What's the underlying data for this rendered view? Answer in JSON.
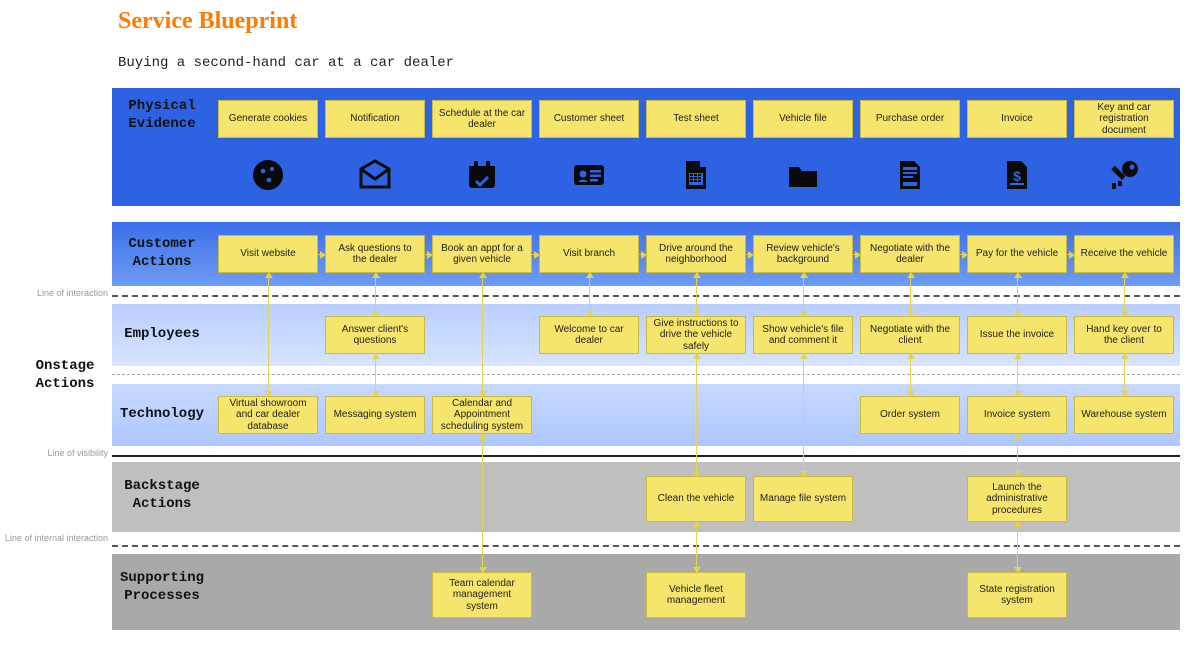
{
  "title": "Service Blueprint",
  "subtitle": "Buying a second-hand car at a car dealer",
  "lanes": {
    "physical": "Physical Evidence",
    "customer": "Customer Actions",
    "onstage": "Onstage Actions",
    "employees": "Employees",
    "technology": "Technology",
    "backstage": "Backstage Actions",
    "supporting": "Supporting Processes"
  },
  "lines": {
    "interaction": "Line of interaction",
    "visibility": "Line of visibility",
    "internal": "Line of internal interaction"
  },
  "columns": [
    {
      "physical": "Generate cookies",
      "icon": "cookie",
      "customer": "Visit website",
      "technology": "Virtual showroom and car dealer database"
    },
    {
      "physical": "Notification",
      "icon": "envelope",
      "customer": "Ask questions to the dealer",
      "employee": "Answer client's questions",
      "technology": "Messaging system"
    },
    {
      "physical": "Schedule at the car dealer",
      "icon": "calendar",
      "customer": "Book an appt for a given vehicle",
      "technology": "Calendar and Appointment scheduling system",
      "supporting": "Team calendar management system"
    },
    {
      "physical": "Customer sheet",
      "icon": "idcard",
      "customer": "Visit branch",
      "employee": "Welcome to car dealer"
    },
    {
      "physical": "Test sheet",
      "icon": "sheet",
      "customer": "Drive around the neighborhood",
      "employee": "Give instructions to drive the vehicle safely",
      "backstage": "Clean the vehicle",
      "supporting": "Vehicle fleet management"
    },
    {
      "physical": "Vehicle file",
      "icon": "folder",
      "customer": "Review vehicle's background",
      "employee": "Show vehicle's file and comment it",
      "backstage": "Manage file system"
    },
    {
      "physical": "Purchase order",
      "icon": "order",
      "customer": "Negotiate with the dealer",
      "employee": "Negotiate with the client",
      "technology": "Order system"
    },
    {
      "physical": "Invoice",
      "icon": "invoice",
      "customer": "Pay for the vehicle",
      "employee": "Issue the invoice",
      "technology": "Invoice system",
      "backstage": "Launch the administrative procedures",
      "supporting": "State registration system"
    },
    {
      "physical": "Key and car registration document",
      "icon": "key",
      "customer": "Receive the vehicle",
      "employee": "Hand key over to the client",
      "technology": "Warehouse system"
    }
  ]
}
